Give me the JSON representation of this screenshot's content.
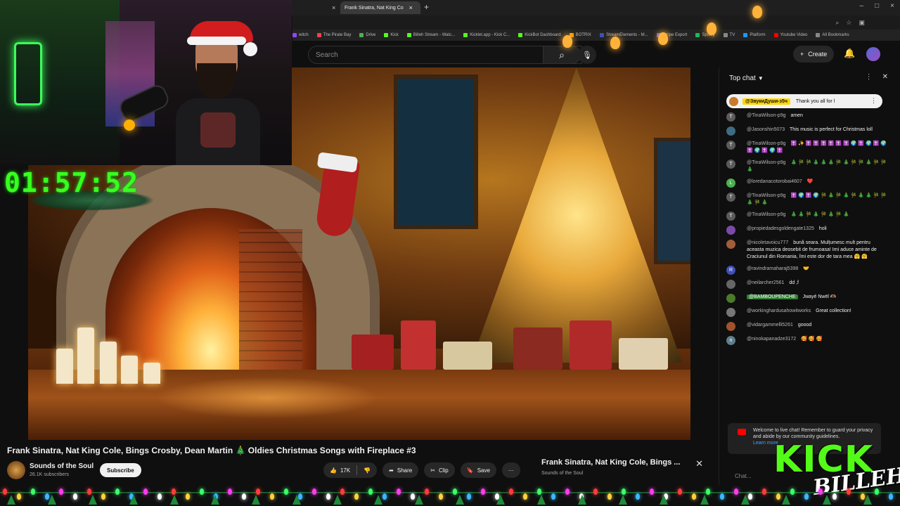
{
  "browser": {
    "tabs": [
      {
        "label": "",
        "active": false
      },
      {
        "label": "Frank Sinatra, Nat King Co",
        "active": true
      }
    ],
    "bookmarks": [
      "witch",
      "The Pirate Bay",
      "Drive",
      "Kick",
      "Billeh Stream - Watc...",
      "Kicklet.app - Kick C...",
      "KickBot Dashboard",
      "BOTRIX",
      "StreamElements - M...",
      "Stripe Export",
      "Spotify",
      "TV",
      "Platform",
      "Youtube Video",
      "All Bookmarks"
    ]
  },
  "youtube": {
    "search_placeholder": "Search",
    "create_label": "Create"
  },
  "stream_overlay": {
    "timer": "01:57:52",
    "kick_word": "KICK",
    "kick_sub": "BILLEH"
  },
  "video": {
    "title": "Frank Sinatra, Nat King Cole, Bings Crosby, Dean Martin 🎄 Oldies Christmas Songs with Fireplace #3",
    "channel_name": "Sounds of the Soul",
    "channel_subs": "26.1K subscribers",
    "subscribe_label": "Subscribe",
    "like_count": "17K",
    "share_label": "Share",
    "clip_label": "Clip",
    "save_label": "Save",
    "more_label": "···"
  },
  "miniplayer": {
    "title": "Frank Sinatra, Nat King Cole, Bings ...",
    "channel": "Sounds of the Soul"
  },
  "chat": {
    "header": "Top chat",
    "pinned": {
      "author": "@ЗвукиДуши-з5ч",
      "text": "Thank you all for l"
    },
    "messages": [
      {
        "initial": "T",
        "color": "#5b5b5b",
        "author": "@TinaWilson-p9g",
        "text": "amen"
      },
      {
        "initial": "",
        "color": "#3f6b83",
        "author": "@Jasonshin5073",
        "text": "This music is perfect for Christmas loll"
      },
      {
        "initial": "T",
        "color": "#5b5b5b",
        "author": "@TinaWilson-p9g",
        "text": "✝️ ✨ ✝️ ✝️ ✝️ ✝️ ✝️ ✝️ 🌍 ✝️ 🌍 ✝️ 🌍 ✝️ 🌍 ✝️ 🌍 ✝️"
      },
      {
        "initial": "T",
        "color": "#5b5b5b",
        "author": "@TinaWilson-p9g",
        "text": "🎄 🎋 🎋 🎄 🎄 🎄 🎋 🎄 🎋 🎋 🎄 🎋 🎋 🎄"
      },
      {
        "initial": "L",
        "color": "#4caf50",
        "author": "@loredanacotorobai4607",
        "text": "❤️"
      },
      {
        "initial": "T",
        "color": "#5b5b5b",
        "author": "@TinaWilson-p9g",
        "text": "✝️ 🌍 ✝️ 🌍 🎋 🎄 🎋 🎄 🎋 🎄 🎄 🎋 🎋 🎄 🎋 🎄"
      },
      {
        "initial": "T",
        "color": "#5b5b5b",
        "author": "@TinaWilson-p9g",
        "text": "🎄 🎄 🎋 🎄 🎋 🎄 🎋 🎄"
      },
      {
        "initial": "",
        "color": "#7a4aa8",
        "author": "@propiedadesgoldengate1325",
        "text": "holi"
      },
      {
        "initial": "",
        "color": "#a15c3a",
        "author": "@nicoletavoicu777",
        "text": "bună seara. Mulțumesc mult pentru aceasta muzica deosebit de frumoasa! Imi aduce aminte de Craciunul din Romania, îmi este dor de tara mea 🤗 🤗"
      },
      {
        "initial": "R",
        "color": "#3f51b5",
        "author": "@ravindramaharaj5398",
        "text": "🤝"
      },
      {
        "initial": "",
        "color": "#666",
        "author": "@neilarcher2561",
        "text": "dd ,f"
      },
      {
        "initial": "",
        "color": "#4a7a2a",
        "author": "@BAMBOUPENCHE",
        "text": "Jwayé Nwël 🫶🏽",
        "member": true
      },
      {
        "initial": "",
        "color": "#777",
        "author": "@workinghardusahowitworks",
        "text": "Great collection!"
      },
      {
        "initial": "",
        "color": "#a0522d",
        "author": "@vidargammelli5261",
        "text": "goood"
      },
      {
        "initial": "n",
        "color": "#607d8b",
        "author": "@ninokapanadze3172",
        "text": "🥰 🥰 🥰"
      }
    ],
    "welcome_text": "Welcome to live chat! Remember to guard your privacy and abide by our community guidelines.",
    "welcome_link": "Learn more",
    "input_placeholder": "Chat..."
  }
}
